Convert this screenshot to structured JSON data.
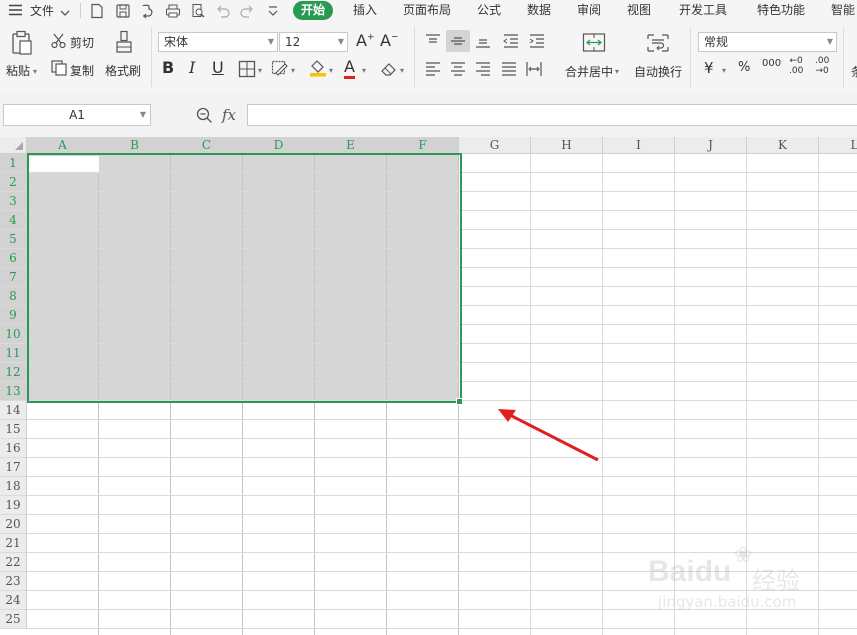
{
  "menubar": {
    "file_label": "文件",
    "tabs": [
      {
        "label": "开始",
        "active": true
      },
      {
        "label": "插入"
      },
      {
        "label": "页面布局"
      },
      {
        "label": "公式"
      },
      {
        "label": "数据"
      },
      {
        "label": "审阅"
      },
      {
        "label": "视图"
      },
      {
        "label": "开发工具"
      },
      {
        "label": "特色功能"
      },
      {
        "label": "智能"
      }
    ]
  },
  "ribbon": {
    "paste_label": "粘贴",
    "cut_label": "剪切",
    "copy_label": "复制",
    "format_painter_label": "格式刷",
    "font_name": "宋体",
    "font_size": "12",
    "bold_label": "B",
    "italic_label": "I",
    "underline_label": "U",
    "font_color_label": "A",
    "grow_font_label": "A",
    "shrink_font_label": "A",
    "merge_center_label": "合并居中",
    "wrap_text_label": "自动换行",
    "number_format": "常规",
    "currency_symbol": "¥",
    "percent_symbol": "%",
    "thousands_symbol": "000",
    "inc_decimal_top": "←0",
    "inc_decimal_bottom": ".00",
    "dec_decimal_top": ".00",
    "dec_decimal_bottom": "→0",
    "cutoff_label": "条"
  },
  "formula_bar": {
    "cell_ref": "A1",
    "fx_label": "fx",
    "formula_value": ""
  },
  "sheet": {
    "columns": [
      "A",
      "B",
      "C",
      "D",
      "E",
      "F",
      "G",
      "H",
      "I",
      "J",
      "K",
      "L"
    ],
    "rows": [
      "1",
      "2",
      "3",
      "4",
      "5",
      "6",
      "7",
      "8",
      "9",
      "10",
      "11",
      "12",
      "13",
      "14",
      "15",
      "16",
      "17",
      "18",
      "19",
      "20",
      "21",
      "22",
      "23",
      "24",
      "25"
    ],
    "selection": "A1:F13",
    "selection_color": "#2a9a52",
    "arrow_color": "#e02020"
  },
  "watermark": {
    "brand": "Bai",
    "brand2": "du",
    "suffix": "经验",
    "url": "jingyan.baidu.com"
  },
  "colors": {
    "accent": "#2a9a52",
    "selected_fill": "#d6d6d6",
    "grid": "#dadada"
  }
}
